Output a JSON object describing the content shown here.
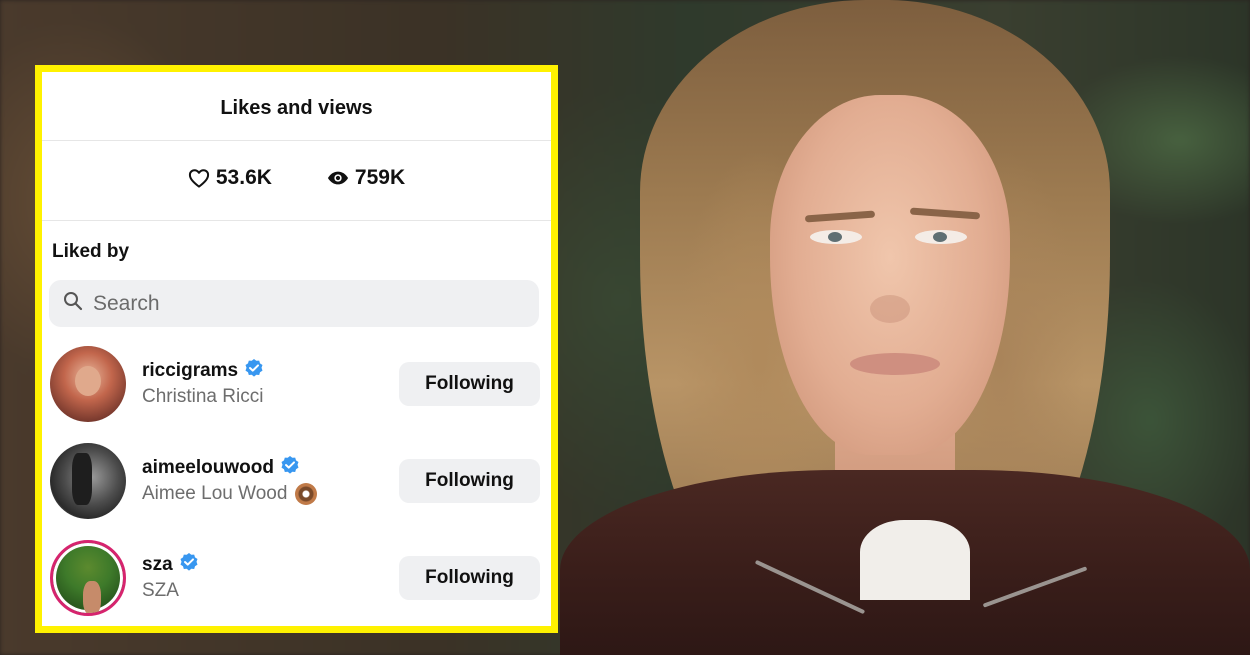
{
  "panel": {
    "title": "Likes and views",
    "stats": {
      "likes": "53.6K",
      "views": "759K"
    },
    "liked_by_heading": "Liked by",
    "search": {
      "placeholder": "Search"
    },
    "users": [
      {
        "username": "riccigrams",
        "full_name": "Christina Ricci",
        "verified": true,
        "button_label": "Following"
      },
      {
        "username": "aimeelouwood",
        "full_name": "Aimee Lou Wood",
        "verified": true,
        "button_label": "Following",
        "emoji": "doughnut"
      },
      {
        "username": "sza",
        "full_name": "SZA",
        "verified": true,
        "button_label": "Following",
        "story_ring": true
      }
    ]
  },
  "colors": {
    "frame_border": "#fff200",
    "verified_badge": "#3897f0",
    "button_bg": "#eff0f2",
    "story_ring": "#d6246e"
  },
  "icons": [
    "heart-icon",
    "eye-icon",
    "search-icon",
    "verified-badge-icon",
    "doughnut-emoji-icon"
  ]
}
